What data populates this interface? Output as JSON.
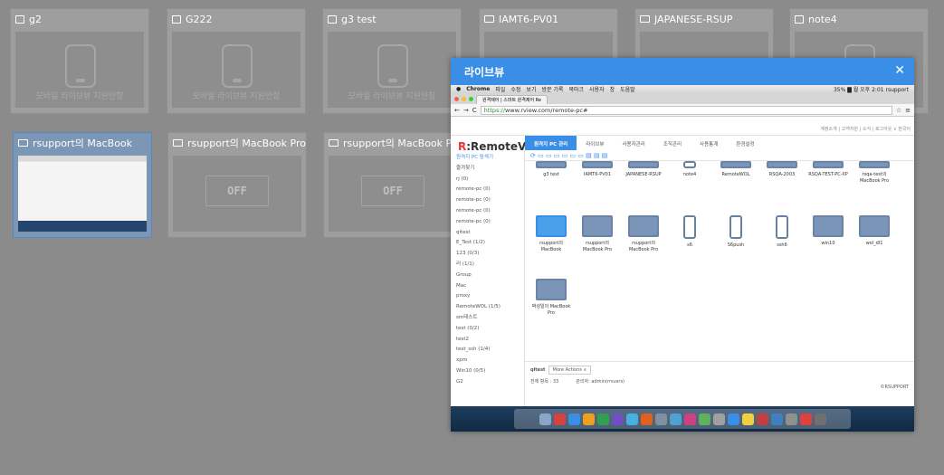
{
  "cards": [
    {
      "title": "g2",
      "icon": "phone-icon",
      "state": "phone",
      "caption": "모바일 라이브뷰 지원안함"
    },
    {
      "title": "G222",
      "icon": "phone-icon",
      "state": "phone",
      "caption": "모바일 라이브뷰 지원안함"
    },
    {
      "title": "g3 test",
      "icon": "phone-icon",
      "state": "phone",
      "caption": "모바일 라이브뷰 지원안함"
    },
    {
      "title": "IAMT6-PV01",
      "icon": "monitor-icon",
      "state": "blank",
      "caption": ""
    },
    {
      "title": "JAPANESE-RSUP",
      "icon": "monitor-icon",
      "state": "blank",
      "caption": ""
    },
    {
      "title": "note4",
      "icon": "phone-icon",
      "state": "phone",
      "caption": ""
    },
    {
      "title": "rsupport의 MacBook",
      "icon": "monitor-icon",
      "state": "live",
      "caption": ""
    },
    {
      "title": "rsupport의 MacBook Pro",
      "icon": "monitor-icon",
      "state": "off",
      "caption": "OFF"
    },
    {
      "title": "rsupport의 MacBook Pro",
      "icon": "monitor-icon",
      "state": "off",
      "caption": "OFF"
    }
  ],
  "popup": {
    "title": "라이브뷰",
    "close": "✕",
    "menubar": {
      "apple": "",
      "items": [
        "Chrome",
        "파일",
        "수정",
        "보기",
        "방문 기록",
        "북마크",
        "사용자",
        "창",
        "도움말"
      ],
      "status": "35% ▇ 월 오후 2:01  rsupport"
    },
    "tab": "원격제어 | 스마트 원격제어 Re",
    "url_secure": "https://",
    "url": "www.rview.com/remote-pc#",
    "app": {
      "logo_r": "R",
      "logo": ":RemoteView",
      "toplinks": "계정소개 | 고객지원 | 소식 | 로그아웃 ∨  한국어",
      "nav": [
        "원격지 PC 관리",
        "라이브뷰",
        "사용자관리",
        "조직관리",
        "사용통계",
        "환경설정"
      ],
      "side": [
        "원격지 PC 탐색기",
        "즐겨찾기",
        "rj (0)",
        "remote-pc (0)",
        "remote-pc (0)",
        "remote-pc (0)",
        "remote-pc (0)",
        "qitest",
        "E_Test (1/2)",
        "123 (0/3)",
        "러 (1/1)",
        "Group",
        "Mac",
        "proxy",
        "RemoteWOL (1/5)",
        "sm테스트",
        "test (0/2)",
        "test2",
        "test_ssh (1/4)",
        "xpro",
        "Win10 (0/5)",
        "G2"
      ],
      "tiles_row1": [
        "g3 test",
        "IAMT6-PV01",
        "JAPANESE-RSUP",
        "note4",
        "RemoteWOL",
        "RSQA-2003",
        "RSQA-TEST-PC-XP",
        "rsqa-test의 MacBook Pro"
      ],
      "tiles_row2": [
        "rsupport의 MacBook",
        "rsupport의 MacBook Pro",
        "rsupport의 MacBook Pro",
        "s6",
        "S6push",
        "ssh6",
        "win10",
        "wol_dl1"
      ],
      "tiles_row3": [
        "박성일의 MacBook Pro"
      ],
      "footer_group": "qitest",
      "footer_action": "More Actions ∧",
      "footer_count": "전체 항목 : 33",
      "footer_admin": "관리자: admin(rrsusrs)",
      "brand": "©RSUPPORT"
    }
  }
}
